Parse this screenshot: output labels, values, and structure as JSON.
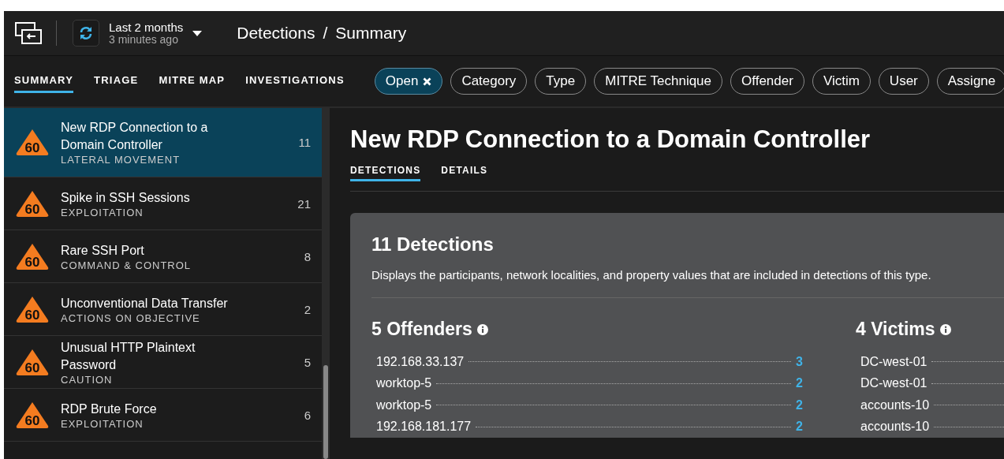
{
  "header": {
    "time_range": "Last 2 months",
    "updated": "3 minutes ago",
    "breadcrumb": [
      "Detections",
      "Summary"
    ],
    "separator": "/"
  },
  "nav_tabs": [
    {
      "label": "SUMMARY",
      "selected": true
    },
    {
      "label": "TRIAGE",
      "selected": false
    },
    {
      "label": "MITRE MAP",
      "selected": false
    },
    {
      "label": "INVESTIGATIONS",
      "selected": false
    }
  ],
  "filters": [
    {
      "label": "Open",
      "selected": true
    },
    {
      "label": "Category",
      "selected": false
    },
    {
      "label": "Type",
      "selected": false
    },
    {
      "label": "MITRE Technique",
      "selected": false
    },
    {
      "label": "Offender",
      "selected": false
    },
    {
      "label": "Victim",
      "selected": false
    },
    {
      "label": "User",
      "selected": false
    },
    {
      "label": "Assigne",
      "selected": false
    }
  ],
  "detections": [
    {
      "risk": "60",
      "title": "New RDP Connection to a Domain Controller",
      "category": "LATERAL MOVEMENT",
      "count": "11",
      "selected": true
    },
    {
      "risk": "60",
      "title": "Spike in SSH Sessions",
      "category": "EXPLOITATION",
      "count": "21",
      "selected": false
    },
    {
      "risk": "60",
      "title": "Rare SSH Port",
      "category": "COMMAND & CONTROL",
      "count": "8",
      "selected": false
    },
    {
      "risk": "60",
      "title": "Unconventional Data Transfer",
      "category": "ACTIONS ON OBJECTIVE",
      "count": "2",
      "selected": false
    },
    {
      "risk": "60",
      "title": "Unusual HTTP Plaintext Password",
      "category": "CAUTION",
      "count": "5",
      "selected": false
    },
    {
      "risk": "60",
      "title": "RDP Brute Force",
      "category": "EXPLOITATION",
      "count": "6",
      "selected": false
    }
  ],
  "detail": {
    "title": "New RDP Connection to a Domain Controller",
    "tabs": [
      {
        "label": "DETECTIONS",
        "selected": true
      },
      {
        "label": "DETAILS",
        "selected": false
      }
    ],
    "card": {
      "heading": "11 Detections",
      "description": "Displays the participants, network localities, and property values that are included in detections of this type.",
      "groups": [
        {
          "heading": "5 Offenders",
          "rows": [
            {
              "name": "192.168.33.137",
              "count": "3"
            },
            {
              "name": "worktop-5",
              "count": "2"
            },
            {
              "name": "worktop-5",
              "count": "2"
            },
            {
              "name": "192.168.181.177",
              "count": "2"
            }
          ]
        },
        {
          "heading": "4 Victims",
          "rows": [
            {
              "name": "DC-west-01"
            },
            {
              "name": "DC-west-01"
            },
            {
              "name": "accounts-10"
            },
            {
              "name": "accounts-10"
            }
          ]
        }
      ]
    }
  }
}
